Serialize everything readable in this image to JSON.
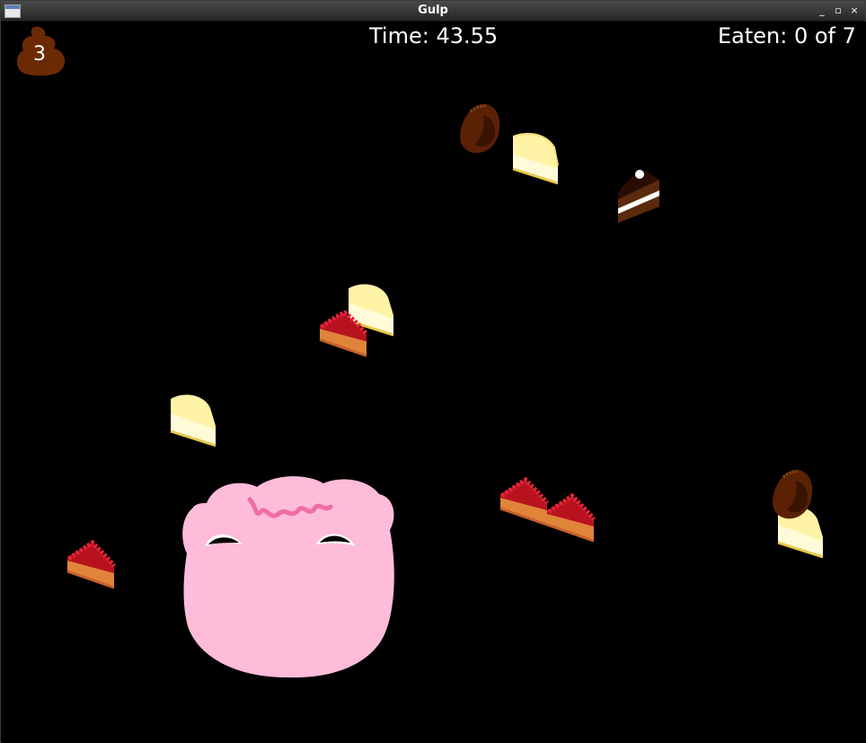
{
  "window": {
    "title": "Gulp",
    "controls": [
      "_",
      "▫",
      "×"
    ]
  },
  "hud": {
    "poop_count": "3",
    "time": "Time: 43.55",
    "eaten": "Eaten: 0 of 7"
  },
  "colors": {
    "background": "#000000",
    "monster": "#ffbcd9",
    "poop": "#6b2a04",
    "cheesecake": "#fff3a6",
    "berry": "#c8102e",
    "crust": "#e0843a"
  },
  "sprites": [
    {
      "name": "chocolate-drop",
      "kind": "chocolate"
    },
    {
      "name": "cheesecake-slice",
      "kind": "cheesecake"
    },
    {
      "name": "chocolate-cake-slice",
      "kind": "chococake"
    },
    {
      "name": "cheesecake-slice",
      "kind": "cheesecake"
    },
    {
      "name": "strawberry-tart-slice",
      "kind": "tart"
    },
    {
      "name": "cheesecake-slice",
      "kind": "cheesecake"
    },
    {
      "name": "strawberry-tart-slice",
      "kind": "tart"
    },
    {
      "name": "strawberry-tart-slice",
      "kind": "tart"
    },
    {
      "name": "strawberry-tart-slice",
      "kind": "tart"
    },
    {
      "name": "cheesecake-slice",
      "kind": "cheesecake"
    },
    {
      "name": "chocolate-drop",
      "kind": "chocolate"
    }
  ]
}
